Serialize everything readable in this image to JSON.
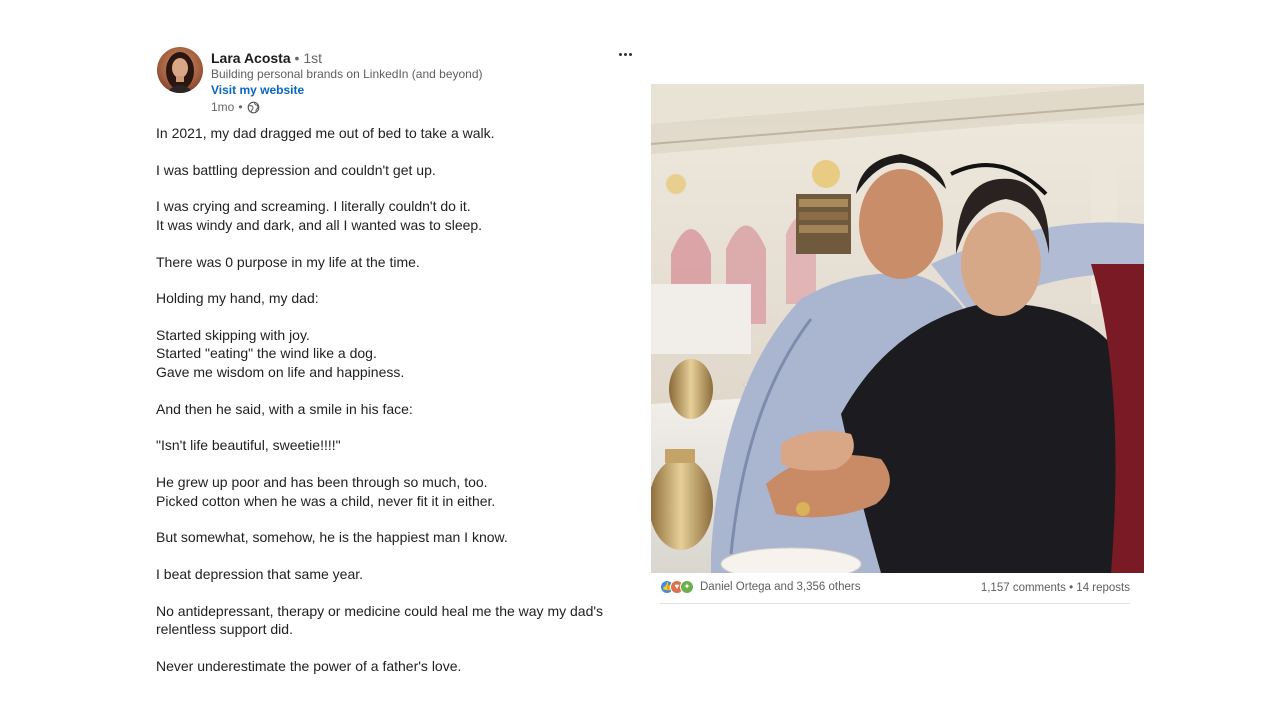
{
  "post": {
    "author": {
      "name": "Lara Acosta",
      "separator": "•",
      "connection_degree": "1st",
      "headline": "Building personal brands on LinkedIn (and beyond)",
      "website_label": "Visit my website",
      "time_ago": "1mo",
      "meta_separator": "•",
      "visibility_icon": "globe-icon"
    },
    "menu_icon": "ellipsis-icon",
    "paragraphs": [
      "In 2021, my dad dragged me out of bed to take a walk.",
      "I was battling depression and couldn't get up.",
      "I was crying and screaming. I literally couldn't do it.\nIt was windy and dark, and all I wanted was to sleep.",
      "There was 0 purpose in my life at the time.",
      "Holding my hand, my dad:",
      "Started skipping with joy.\nStarted \"eating\" the wind like a dog.\nGave me wisdom on life and happiness.",
      "And then he said, with a smile in his face:",
      "\"Isn't life beautiful, sweetie!!!!\"",
      "He grew up poor and has been through so much, too.\nPicked cotton when he was a child, never fit it in either.",
      "But somewhat, somehow, he is the happiest man I know.",
      "I beat depression that same year.",
      "No antidepressant, therapy or medicine could heal me the way my dad's\nrelentless support did.",
      "Never underestimate the power of a father's love."
    ]
  },
  "photo": {
    "subject": "photo of father and daughter seated at a table in an ornate tea room"
  },
  "social": {
    "reaction_icons": [
      {
        "name": "like-icon",
        "color": "#378fe9",
        "glyph": "👍"
      },
      {
        "name": "love-icon",
        "color": "#df704d",
        "glyph": "♥"
      },
      {
        "name": "celebrate-icon",
        "color": "#6dae4f",
        "glyph": "✦"
      }
    ],
    "reactions_text": "Daniel Ortega and 3,356 others",
    "comments": "1,157 comments",
    "separator": "•",
    "reposts": "14 reposts"
  },
  "colors": {
    "link": "#0a66c2",
    "text": "#1f1f1f",
    "muted": "#666666"
  }
}
